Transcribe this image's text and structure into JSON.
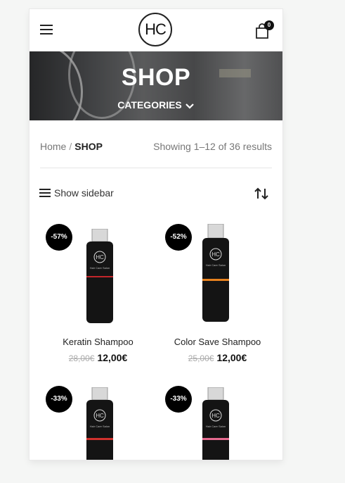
{
  "header": {
    "logo_text": "HC",
    "cart_count": "0"
  },
  "hero": {
    "title": "SHOP",
    "categories_label": "CATEGORIES"
  },
  "breadcrumb": {
    "home": "Home",
    "separator": "/",
    "current": "SHOP"
  },
  "results_text": "Showing 1–12 of 36 results",
  "toolbar": {
    "sidebar_label": "Show sidebar"
  },
  "products": [
    {
      "name": "Keratin Shampoo",
      "old_price": "28,00€",
      "price": "12,00€",
      "discount": "-57%",
      "bottle_label": "HC",
      "bottle_sub": "Hair Care Salon",
      "stripe_color": "#c3262b"
    },
    {
      "name": "Color Save Shampoo",
      "old_price": "25,00€",
      "price": "12,00€",
      "discount": "-52%",
      "bottle_label": "HC",
      "bottle_sub": "Hair Care Salon",
      "stripe_color": "#e8821f"
    },
    {
      "discount": "-33%",
      "bottle_label": "HC",
      "bottle_sub": "Hair Care Salon",
      "stripe_color": "#d0312d"
    },
    {
      "discount": "-33%",
      "bottle_label": "HC",
      "bottle_sub": "Hair Care Salon",
      "stripe_color": "#e56a8f"
    }
  ]
}
